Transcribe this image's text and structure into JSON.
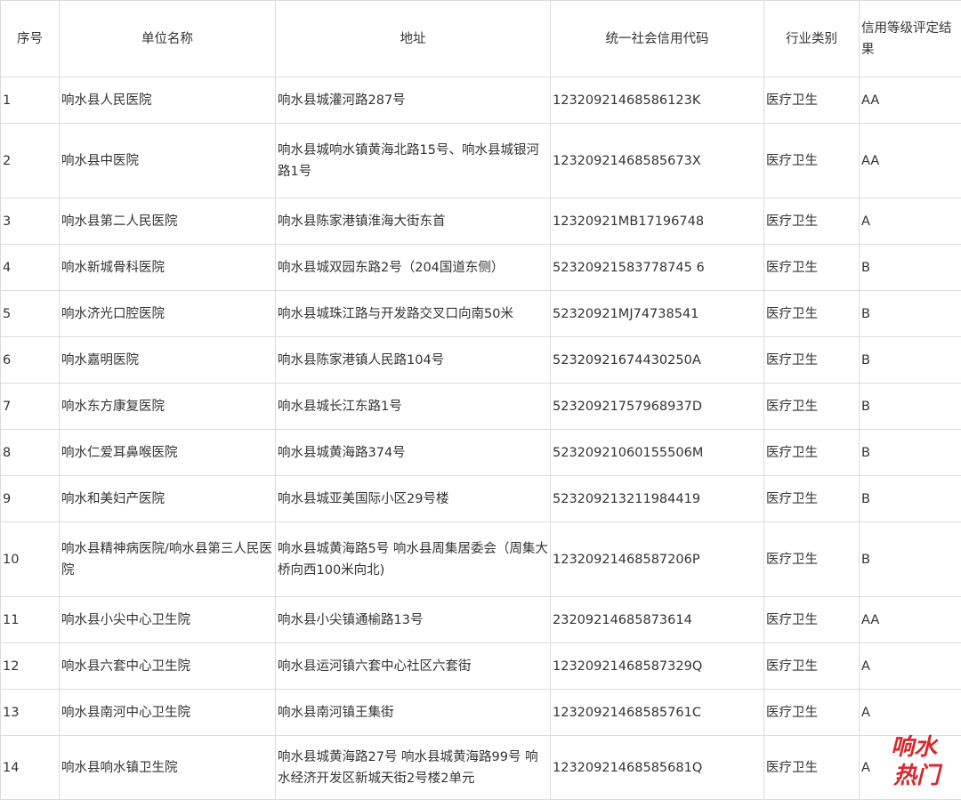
{
  "table": {
    "headers": [
      "序号",
      "单位名称",
      "地址",
      "统一社会信用代码",
      "行业类别",
      "信用等级评定结果"
    ],
    "rows": [
      {
        "no": "1",
        "name": "响水县人民医院",
        "address": "响水县城灌河路287号",
        "code": "12320921468586123K",
        "industry": "医疗卫生",
        "grade": "AA"
      },
      {
        "no": "2",
        "name": "响水县中医院",
        "address": "响水县城响水镇黄海北路15号、响水县城银河路1号",
        "code": "12320921468585673X",
        "industry": "医疗卫生",
        "grade": "AA"
      },
      {
        "no": "3",
        "name": "响水县第二人民医院",
        "address": "响水县陈家港镇淮海大街东首",
        "code": "12320921MB17196748",
        "industry": "医疗卫生",
        "grade": "A"
      },
      {
        "no": "4",
        "name": "响水新城骨科医院",
        "address": "响水县城双园东路2号（204国道东侧）",
        "code": "52320921583778745 6",
        "industry": "医疗卫生",
        "grade": "B"
      },
      {
        "no": "5",
        "name": "响水济光口腔医院",
        "address": "响水县城珠江路与开发路交叉口向南50米",
        "code": "52320921MJ74738541",
        "industry": "医疗卫生",
        "grade": "B"
      },
      {
        "no": "6",
        "name": "响水嘉明医院",
        "address": "响水县陈家港镇人民路104号",
        "code": "52320921674430250A",
        "industry": "医疗卫生",
        "grade": "B"
      },
      {
        "no": "7",
        "name": "响水东方康复医院",
        "address": "响水县城长江东路1号",
        "code": "52320921757968937D",
        "industry": "医疗卫生",
        "grade": "B"
      },
      {
        "no": "8",
        "name": "响水仁爱耳鼻喉医院",
        "address": "响水县城黄海路374号",
        "code": "52320921060155506M",
        "industry": "医疗卫生",
        "grade": "B"
      },
      {
        "no": "9",
        "name": "响水和美妇产医院",
        "address": "响水县城亚美国际小区29号楼",
        "code": "523209213211984419",
        "industry": "医疗卫生",
        "grade": "B"
      },
      {
        "no": "10",
        "name": "响水县精神病医院/响水县第三人民医院",
        "address": "响水县城黄海路5号 响水县周集居委会（周集大桥向西100米向北)",
        "code": "12320921468587206P",
        "industry": "医疗卫生",
        "grade": "B"
      },
      {
        "no": "11",
        "name": "响水县小尖中心卫生院",
        "address": "响水县小尖镇通榆路13号",
        "code": "23209214685873614",
        "industry": "医疗卫生",
        "grade": "AA"
      },
      {
        "no": "12",
        "name": "响水县六套中心卫生院",
        "address": "响水县运河镇六套中心社区六套街",
        "code": "12320921468587329Q",
        "industry": "医疗卫生",
        "grade": "A"
      },
      {
        "no": "13",
        "name": "响水县南河中心卫生院",
        "address": "响水县南河镇王集街",
        "code": "12320921468585761C",
        "industry": "医疗卫生",
        "grade": "A"
      },
      {
        "no": "14",
        "name": "响水县响水镇卫生院",
        "address": "响水县城黄海路27号 响水县城黄海路99号 响水经济开发区新城天街2号楼2单元",
        "code": "12320921468585681Q",
        "industry": "医疗卫生",
        "grade": "A"
      }
    ]
  },
  "watermark": {
    "line1": "响水",
    "line2": "热门",
    "color": "#d7282f"
  }
}
